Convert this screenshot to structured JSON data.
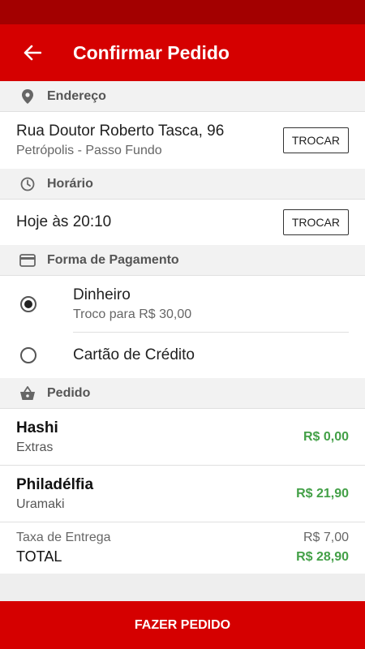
{
  "header": {
    "title": "Confirmar Pedido"
  },
  "address": {
    "section_label": "Endereço",
    "street": "Rua Doutor Roberto Tasca, 96",
    "neighborhood": "Petrópolis - Passo Fundo",
    "change_label": "TROCAR"
  },
  "schedule": {
    "section_label": "Horário",
    "time": "Hoje às 20:10",
    "change_label": "TROCAR"
  },
  "payment": {
    "section_label": "Forma de Pagamento",
    "options": [
      {
        "label": "Dinheiro",
        "sub": "Troco para R$ 30,00",
        "selected": true
      },
      {
        "label": "Cartão de Crédito",
        "selected": false
      }
    ]
  },
  "order": {
    "section_label": "Pedido",
    "items": [
      {
        "name": "Hashi",
        "sub": "Extras",
        "price": "R$ 0,00"
      },
      {
        "name": "Philadélfia",
        "sub": "Uramaki",
        "price": "R$ 21,90"
      }
    ],
    "delivery_label": "Taxa de Entrega",
    "delivery_value": "R$ 7,00",
    "total_label": "TOTAL",
    "total_value": "R$ 28,90"
  },
  "footer": {
    "submit_label": "FAZER PEDIDO"
  },
  "colors": {
    "primary": "#d50000",
    "status_bar": "#a30000",
    "price": "#43a047"
  }
}
